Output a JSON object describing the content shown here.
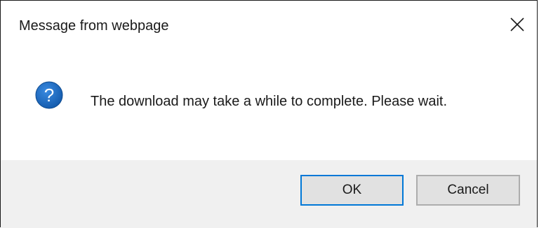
{
  "dialog": {
    "title": "Message from webpage",
    "message": "The download may take a while to complete. Please wait.",
    "icon": "question-icon",
    "close_icon": "close-icon",
    "buttons": {
      "ok_label": "OK",
      "cancel_label": "Cancel"
    }
  },
  "colors": {
    "icon_fill": "#1e6fc4",
    "focus_border": "#0078d7",
    "footer_bg": "#f0f0f0",
    "button_bg": "#e1e1e1"
  }
}
